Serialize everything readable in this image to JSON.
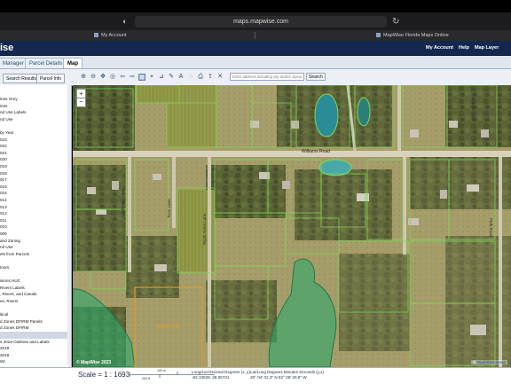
{
  "browser": {
    "url": "maps.mapwise.com",
    "tabs": [
      "My Account",
      "MapWise Florida Maps Online"
    ]
  },
  "site": {
    "logo": "ise",
    "nav": [
      "My Account",
      "Help",
      "Map Layer Direct"
    ]
  },
  "app_tabs": [
    "Manager",
    "Parcel Details",
    "Map"
  ],
  "left_tabs": [
    "Search Results",
    "Parcel Info"
  ],
  "toolbar": {
    "search_placeholder": "Enter address including city and/or zipcode",
    "search_label": "Search",
    "tools": [
      "zoom-in-tool-icon",
      "zoom-out-tool-icon",
      "pan-tool-icon",
      "full-extent-icon",
      "back-icon",
      "forward-icon",
      "select-icon",
      "identify-icon",
      "measure-icon",
      "draw-icon",
      "label-icon",
      "buffer-icon",
      "print-icon",
      "export-icon",
      "clear-icon",
      "info-icon"
    ]
  },
  "layers": [
    "ines Grey",
    "ines",
    "nd Use Labels",
    "nd Use",
    "",
    "by Year",
    "023",
    "022",
    "021",
    "020",
    "019",
    "018",
    "017",
    "016",
    "015",
    "014",
    "013",
    "012",
    "011",
    "010",
    "009",
    "and Zoning",
    "nd Use",
    "els from Parcels",
    "",
    "tours",
    "",
    "isions HUC",
    " Rivers Labels",
    ", Rivers, and Canals",
    "es, Rivers",
    "",
    "itical",
    "d Zones DFIRM Panels",
    "d Zones DFIRM",
    "",
    "s 2019 Outlines and Labels",
    "2019",
    "2019",
    "WI"
  ],
  "selected_layer_index": 35,
  "map": {
    "road_label": "Williams Road",
    "place_label": "PLANT CITY",
    "copyright": "© MapWise 2023",
    "osm_prefix": "© ",
    "osm_link": "OpenStreetMap"
  },
  "status": {
    "scale": "Scale = 1 : 1693",
    "scalebar_top": "100 m",
    "scalebar_bottom": "200 ft",
    "lonlat_label": "Long/Lat Decimal Degrees (x, y)",
    "lonlat_value": "-82.10829, 28.06731",
    "dms_label": "Lat/Long Degrees Minutes Seconds (y,x)",
    "dms_value": "28° 04' 02.3\" N 82° 06' 29.8\" W"
  },
  "colors": {
    "header": "#14284f",
    "parcel_line": "#7ed957",
    "flood_zone": "#2fa86b",
    "city_boundary": "#e39a2b",
    "pond": "#2a8c97"
  }
}
